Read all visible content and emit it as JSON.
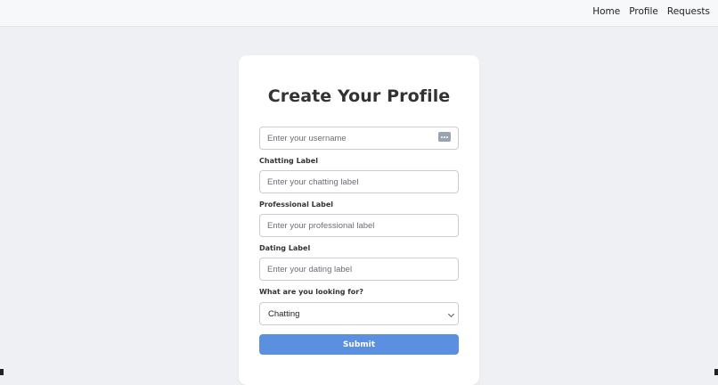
{
  "nav": {
    "items": [
      "Home",
      "Profile",
      "Requests"
    ]
  },
  "form": {
    "title": "Create Your Profile",
    "username": {
      "placeholder": "Enter your username",
      "value": ""
    },
    "chatting": {
      "label": "Chatting Label",
      "placeholder": "Enter your chatting label",
      "value": ""
    },
    "professional": {
      "label": "Professional Label",
      "placeholder": "Enter your professional label",
      "value": ""
    },
    "dating": {
      "label": "Dating Label",
      "placeholder": "Enter your dating label",
      "value": ""
    },
    "looking_for": {
      "label": "What are you looking for?",
      "selected": "Chatting"
    },
    "submit_label": "Submit"
  },
  "colors": {
    "accent": "#5b8fdf",
    "background": "#eef0f4",
    "card": "#ffffff"
  },
  "icons": {
    "username_field_icon": "keyboard-icon",
    "select_icon": "chevron-down-icon"
  }
}
